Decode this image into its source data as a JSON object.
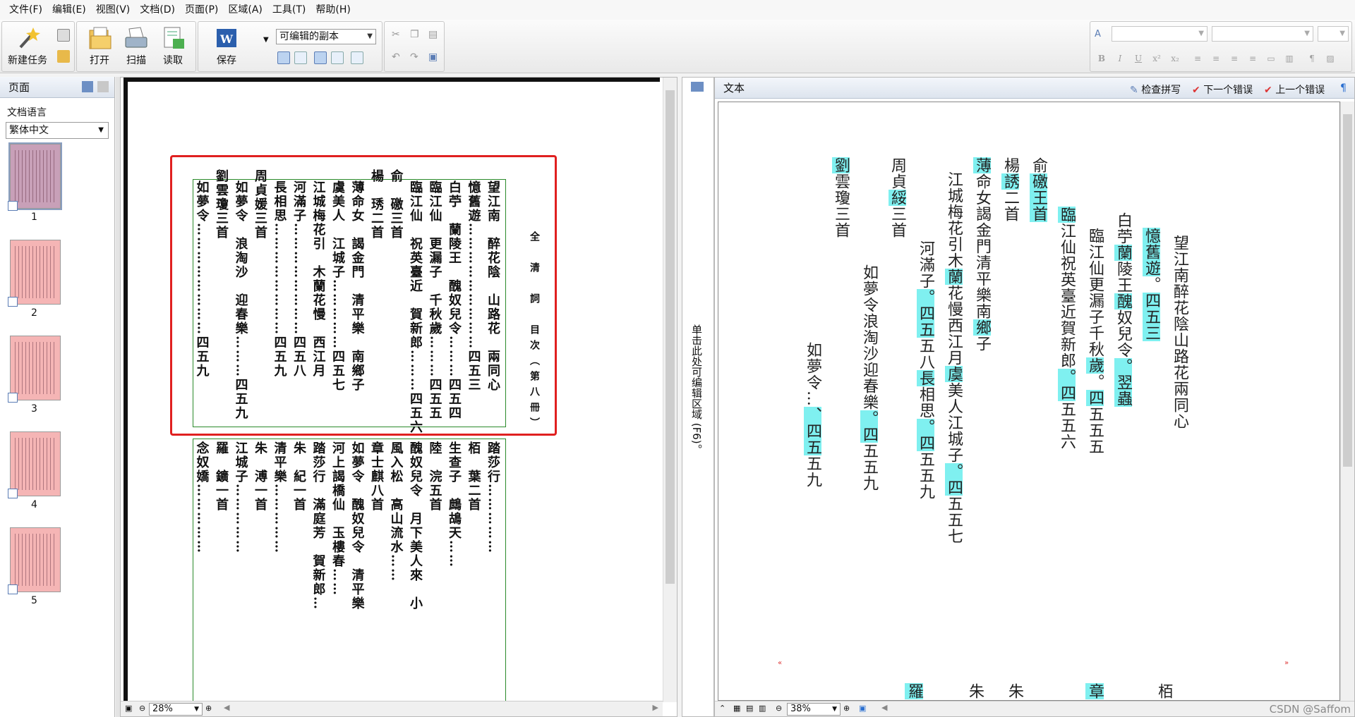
{
  "menu": [
    "文件(F)",
    "编辑(E)",
    "视图(V)",
    "文档(D)",
    "页面(P)",
    "区域(A)",
    "工具(T)",
    "帮助(H)"
  ],
  "toolbar": {
    "new_task": "新建任务",
    "open": "打开",
    "scan": "扫描",
    "read": "读取",
    "save": "保存",
    "save_mode": "可编辑的副本"
  },
  "pages_panel": {
    "title": "页面",
    "lang_label": "文档语言",
    "lang_value": "繁体中文",
    "thumbnails": [
      "1",
      "2",
      "3",
      "4",
      "5"
    ]
  },
  "image_view": {
    "zoom": "28%",
    "columns_top": [
      "望江南　醉花陰　山路花　兩同心",
      "憶舊遊………………………四五三",
      "白苧　蘭陵王　醜奴兒令………四五四",
      "臨江仙　更漏子　千秋歲………四五五",
      "臨江仙　祝英臺近　賀新郎………四五六",
      "俞　礉三首",
      "楊　琇二首",
      "薄命女　謁金門　清平樂　南鄉子",
      "虞美人　江城子……………四五七",
      "江城梅花引　木蘭花慢　西江月",
      "河滿子……………………四五八",
      "長相思……………………四五九",
      "周貞媛三首",
      "如夢令　浪淘沙　迎春樂………四五九",
      "劉雲瓊三首",
      "如夢令……………………四五九"
    ],
    "title_col": "全　清　詞　目次（第八冊）",
    "columns_bottom": [
      "踏莎行……………",
      "栢　葉二首",
      "生查子　鷓鴣天……",
      "陸　浣五首",
      "醜奴兒令　月下美人來　小",
      "風入松　高山流水……",
      "章士麒八首",
      "如夢令　醜奴兒令　清平樂",
      "河上謁橋仙　玉樓春……",
      "踏莎行　滿庭芳　賀新郎…",
      "朱　紀一首",
      "清平樂……………",
      "朱　溥一首",
      "江城子……………",
      "羅　鑛一首",
      "念奴嬌……………"
    ]
  },
  "center_strip_text": "单击此处可编辑区域 (F6)。",
  "text_view": {
    "title": "文本",
    "check_spelling": "检查拼写",
    "next_error": "下一个错误",
    "prev_error": "上一个错误",
    "zoom": "38%",
    "columns": [
      [
        {
          "t": "望江南醉花陰山路花兩同心"
        }
      ],
      [
        {
          "t": "憶舊遊",
          "h": true
        },
        {
          "t": "。"
        },
        {
          "t": "四五三",
          "h": true
        }
      ],
      [
        {
          "t": "白苧"
        },
        {
          "t": "蘭",
          "h": true
        },
        {
          "t": "陵王"
        },
        {
          "t": "醜",
          "h": true
        },
        {
          "t": "奴兒令"
        },
        {
          "t": "。",
          "h": true
        },
        {
          "t": "翌",
          "h": true
        },
        {
          "t": "蟲",
          "h": true
        }
      ],
      [
        {
          "t": "臨江仙更漏子千秋"
        },
        {
          "t": "歲",
          "h": true
        },
        {
          "t": "。"
        },
        {
          "t": "四",
          "h": true
        },
        {
          "t": "五五五"
        }
      ],
      [
        {
          "t": "臨",
          "h": true
        },
        {
          "t": "江仙祝英臺近賀新郎"
        },
        {
          "t": "。",
          "h": true
        },
        {
          "t": "四",
          "h": true
        },
        {
          "t": "五五六"
        }
      ],
      [
        {
          "t": "俞"
        },
        {
          "t": "礉王首",
          "h": true
        }
      ],
      [
        {
          "t": "楊"
        },
        {
          "t": "誘",
          "h": true
        },
        {
          "t": "二首"
        }
      ],
      [
        {
          "t": "薄",
          "h": true
        },
        {
          "t": "命女謁金門清平樂南"
        },
        {
          "t": "鄉",
          "h": true
        },
        {
          "t": "子"
        }
      ],
      [
        {
          "t": "江城梅花引木"
        },
        {
          "t": "蘭",
          "h": true
        },
        {
          "t": "花慢西江月"
        },
        {
          "t": "虞",
          "h": true
        },
        {
          "t": "美人江城子"
        },
        {
          "t": "。",
          "h": true
        },
        {
          "t": "四",
          "h": true
        },
        {
          "t": "五五七"
        }
      ],
      [
        {
          "t": "河滿子"
        },
        {
          "t": "。",
          "h": true
        },
        {
          "t": "四",
          "h": true
        },
        {
          "t": "五",
          "h": true
        },
        {
          "t": "五八"
        },
        {
          "t": "長",
          "h": true
        },
        {
          "t": "相思"
        },
        {
          "t": "。",
          "h": true
        },
        {
          "t": "四",
          "h": true
        },
        {
          "t": "五五九"
        }
      ],
      [
        {
          "t": "周貞"
        },
        {
          "t": "綏",
          "h": true
        },
        {
          "t": "三首"
        }
      ],
      [
        {
          "t": "如夢令浪淘沙迎春樂"
        },
        {
          "t": "。",
          "h": true
        },
        {
          "t": "四",
          "h": true
        },
        {
          "t": "五五九"
        }
      ],
      [
        {
          "t": "劉",
          "h": true
        },
        {
          "t": "雲瓊三首"
        }
      ],
      [
        {
          "t": "如夢令"
        },
        {
          "t": "…"
        },
        {
          "t": "、",
          "h": true
        },
        {
          "t": "四",
          "h": true
        },
        {
          "t": "五",
          "h": true
        },
        {
          "t": "五九"
        }
      ]
    ],
    "bottom_chars": [
      "栢",
      "章",
      "朱",
      "朱",
      "羅"
    ]
  },
  "watermark": "CSDN @Saffom"
}
